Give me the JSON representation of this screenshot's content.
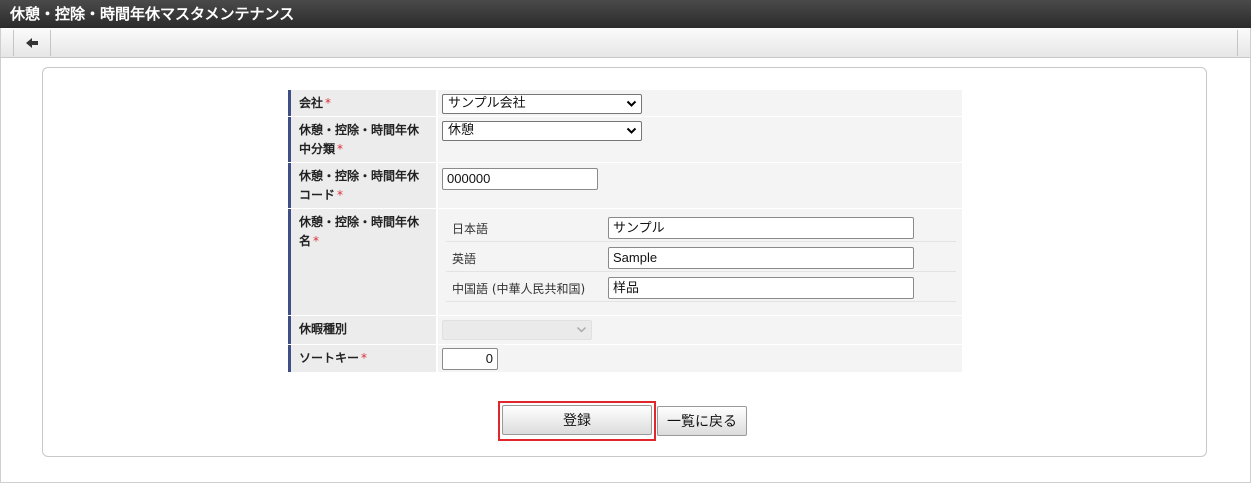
{
  "window": {
    "title": "休憩・控除・時間年休マスタメンテナンス"
  },
  "toolbar": {
    "back_icon": "arrow-left-icon"
  },
  "form": {
    "required_mark": "*",
    "company": {
      "label": "会社",
      "value": "サンプル会社"
    },
    "category": {
      "label_line1": "休憩・控除・時間年休",
      "label_line2": "中分類",
      "value": "休憩"
    },
    "code": {
      "label_line1": "休憩・控除・時間年休",
      "label_line2": "コード",
      "value": "000000"
    },
    "name": {
      "label_line1": "休憩・控除・時間年休",
      "label_line2": "名",
      "languages": [
        {
          "label": "日本語",
          "value": "サンプル"
        },
        {
          "label": "英語",
          "value": "Sample"
        },
        {
          "label": "中国語 (中華人民共和国)",
          "value": "样品"
        }
      ]
    },
    "leave_type": {
      "label": "休暇種別",
      "value": ""
    },
    "sort_key": {
      "label": "ソートキー",
      "value": "0"
    }
  },
  "buttons": {
    "register": "登録",
    "back_to_list": "一覧に戻る"
  }
}
